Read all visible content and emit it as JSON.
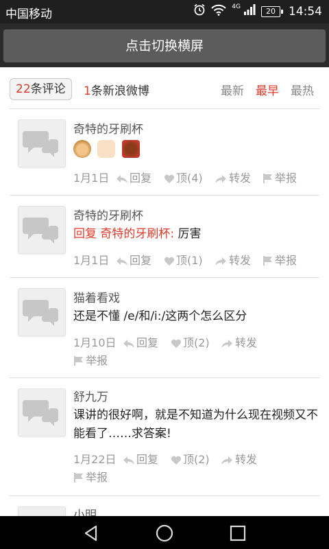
{
  "status_bar": {
    "carrier": "中国移动",
    "network": "4G",
    "battery": "20",
    "time": "14:54"
  },
  "header": {
    "landscape_button": "点击切换横屏"
  },
  "filters": {
    "comment_count_num": "22",
    "comment_count_label": "条评论",
    "weibo_count_num": "1",
    "weibo_count_label": "条新浪微博",
    "sort_newest": "最新",
    "sort_earliest": "最早",
    "sort_hottest": "最热"
  },
  "comments": [
    {
      "user": "奇特的牙刷杯",
      "reply_prefix": "",
      "text": "",
      "emojis": [
        "monkey-emoji",
        "thumbs-up-emoji",
        "angry-face-emoji"
      ],
      "date": "1月1日",
      "reply": "回复",
      "like": "顶(4)",
      "forward": "转发",
      "report": "举报"
    },
    {
      "user": "奇特的牙刷杯",
      "reply_prefix": "回复 奇特的牙刷杯:",
      "text": "厉害",
      "date": "1月1日",
      "reply": "回复",
      "like": "顶(1)",
      "forward": "转发",
      "report": "举报"
    },
    {
      "user": "猫着看戏",
      "reply_prefix": "",
      "text": "还是不懂 /e/和/i:/这两个怎么区分",
      "date": "1月10日",
      "reply": "回复",
      "like": "顶(2)",
      "forward": "转发",
      "report": "举报"
    },
    {
      "user": "舒九万",
      "reply_prefix": "",
      "text": "课讲的很好啊，就是不知道为什么现在视频又不能看了……求答案!",
      "date": "1月22日",
      "reply": "回复",
      "like": "顶(2)",
      "forward": "转发",
      "report": "举报"
    },
    {
      "user": "小明"
    }
  ],
  "colors": {
    "accent_red": "#e03a2a",
    "status_bar_bg": "#1f1f1f",
    "header_button_bg": "#5c5c5c"
  }
}
